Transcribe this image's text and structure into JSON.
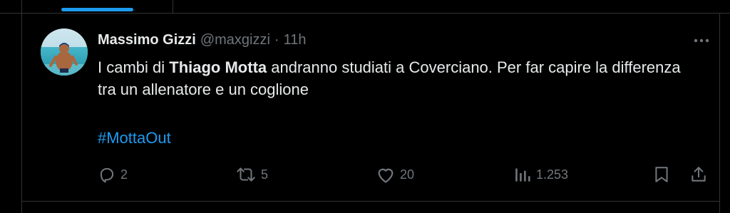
{
  "tweet": {
    "author": {
      "display_name": "Massimo Gizzi",
      "handle": "@maxgizzi",
      "separator": "·",
      "time": "11h"
    },
    "text": {
      "part1": "I cambi di ",
      "bold": "Thiago Motta",
      "part2": " andranno studiati a Coverciano. Per far capire la differenza tra un allenatore e un coglione"
    },
    "hashtag": "#MottaOut",
    "actions": {
      "replies": "2",
      "reposts": "5",
      "likes": "20",
      "views": "1.253"
    }
  },
  "icons": {
    "more": "more-horizontal-icon",
    "reply": "reply-icon",
    "repost": "repost-icon",
    "like": "heart-icon",
    "views": "views-chart-icon",
    "bookmark": "bookmark-icon",
    "share": "share-icon"
  },
  "colors": {
    "background": "#000000",
    "text": "#e7e9ea",
    "secondary": "#71767b",
    "accent": "#1d9bf0",
    "border": "#2f3336"
  }
}
